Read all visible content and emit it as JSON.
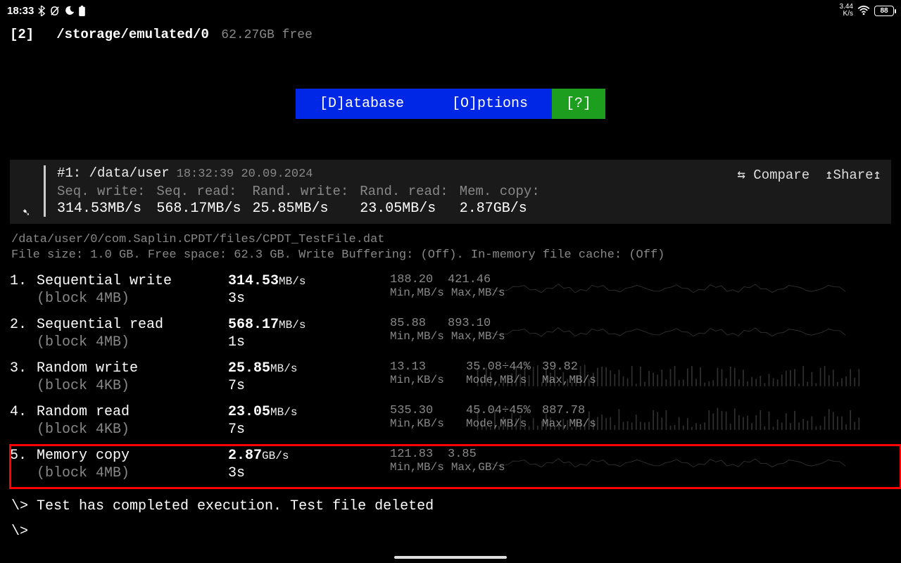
{
  "statusbar": {
    "time": "18:33",
    "net_speed_value": "3.44",
    "net_speed_unit": "K/s",
    "battery_pct": "88"
  },
  "pathbar": {
    "index": "[2]",
    "path": "/storage/emulated/0",
    "free": "62.27GB free"
  },
  "menu": {
    "database": "[D]atabase",
    "options": "[O]ptions",
    "help": "[?]"
  },
  "summary": {
    "title": "#1: /data/user",
    "timestamp": "18:32:39 20.09.2024",
    "compare": "⇆ Compare",
    "share": "↥Share↥",
    "cols": [
      {
        "label": "Seq. write:",
        "value": "314.53MB/s"
      },
      {
        "label": "Seq. read:",
        "value": "568.17MB/s"
      },
      {
        "label": "Rand. write:",
        "value": "25.85MB/s"
      },
      {
        "label": "Rand. read:",
        "value": "23.05MB/s"
      },
      {
        "label": "Mem. copy:",
        "value": "2.87GB/s"
      }
    ]
  },
  "meta": {
    "line1": "/data/user/0/com.Saplin.CPDT/files/CPDT_TestFile.dat",
    "line2": "File size: 1.0 GB. Free space: 62.3 GB. Write Buffering: (Off). In-memory file cache: (Off)"
  },
  "rows": [
    {
      "n": "1.",
      "name": "Sequential write",
      "block": "(block 4MB)",
      "val": "314.53",
      "unit": "MB/s",
      "dur": "3s",
      "stat_vals": [
        "188.20",
        "421.46"
      ],
      "stat_lbls": [
        "Min,MB/s",
        "Max,MB/s"
      ],
      "highlight": false,
      "graph": "wave"
    },
    {
      "n": "2.",
      "name": "Sequential read",
      "block": "(block 4MB)",
      "val": "568.17",
      "unit": "MB/s",
      "dur": "1s",
      "stat_vals": [
        "85.88",
        "893.10"
      ],
      "stat_lbls": [
        "Min,MB/s",
        "Max,MB/s"
      ],
      "highlight": false,
      "graph": "wave"
    },
    {
      "n": "3.",
      "name": "Random write",
      "block": "(block 4KB)",
      "val": "25.85",
      "unit": "MB/s",
      "dur": "7s",
      "stat_vals": [
        "13.13",
        "35.08÷44%",
        "39.82"
      ],
      "stat_lbls": [
        "Min,KB/s",
        "Mode,MB/s",
        "Max,MB/s"
      ],
      "highlight": false,
      "graph": "bars"
    },
    {
      "n": "4.",
      "name": "Random read",
      "block": "(block 4KB)",
      "val": "23.05",
      "unit": "MB/s",
      "dur": "7s",
      "stat_vals": [
        "535.30",
        "45.04÷45%",
        "887.78"
      ],
      "stat_lbls": [
        "Min,KB/s",
        "Mode,MB/s",
        "Max,MB/s"
      ],
      "highlight": false,
      "graph": "bars"
    },
    {
      "n": "5.",
      "name": "Memory copy",
      "block": "(block 4MB)",
      "val": "2.87",
      "unit": "GB/s",
      "dur": "3s",
      "stat_vals": [
        "121.83",
        "3.85"
      ],
      "stat_lbls": [
        "Min,MB/s",
        "Max,GB/s"
      ],
      "highlight": true,
      "graph": "wave"
    }
  ],
  "footer": {
    "line1": "\\> Test has completed execution. Test file deleted",
    "line2": "\\>"
  }
}
